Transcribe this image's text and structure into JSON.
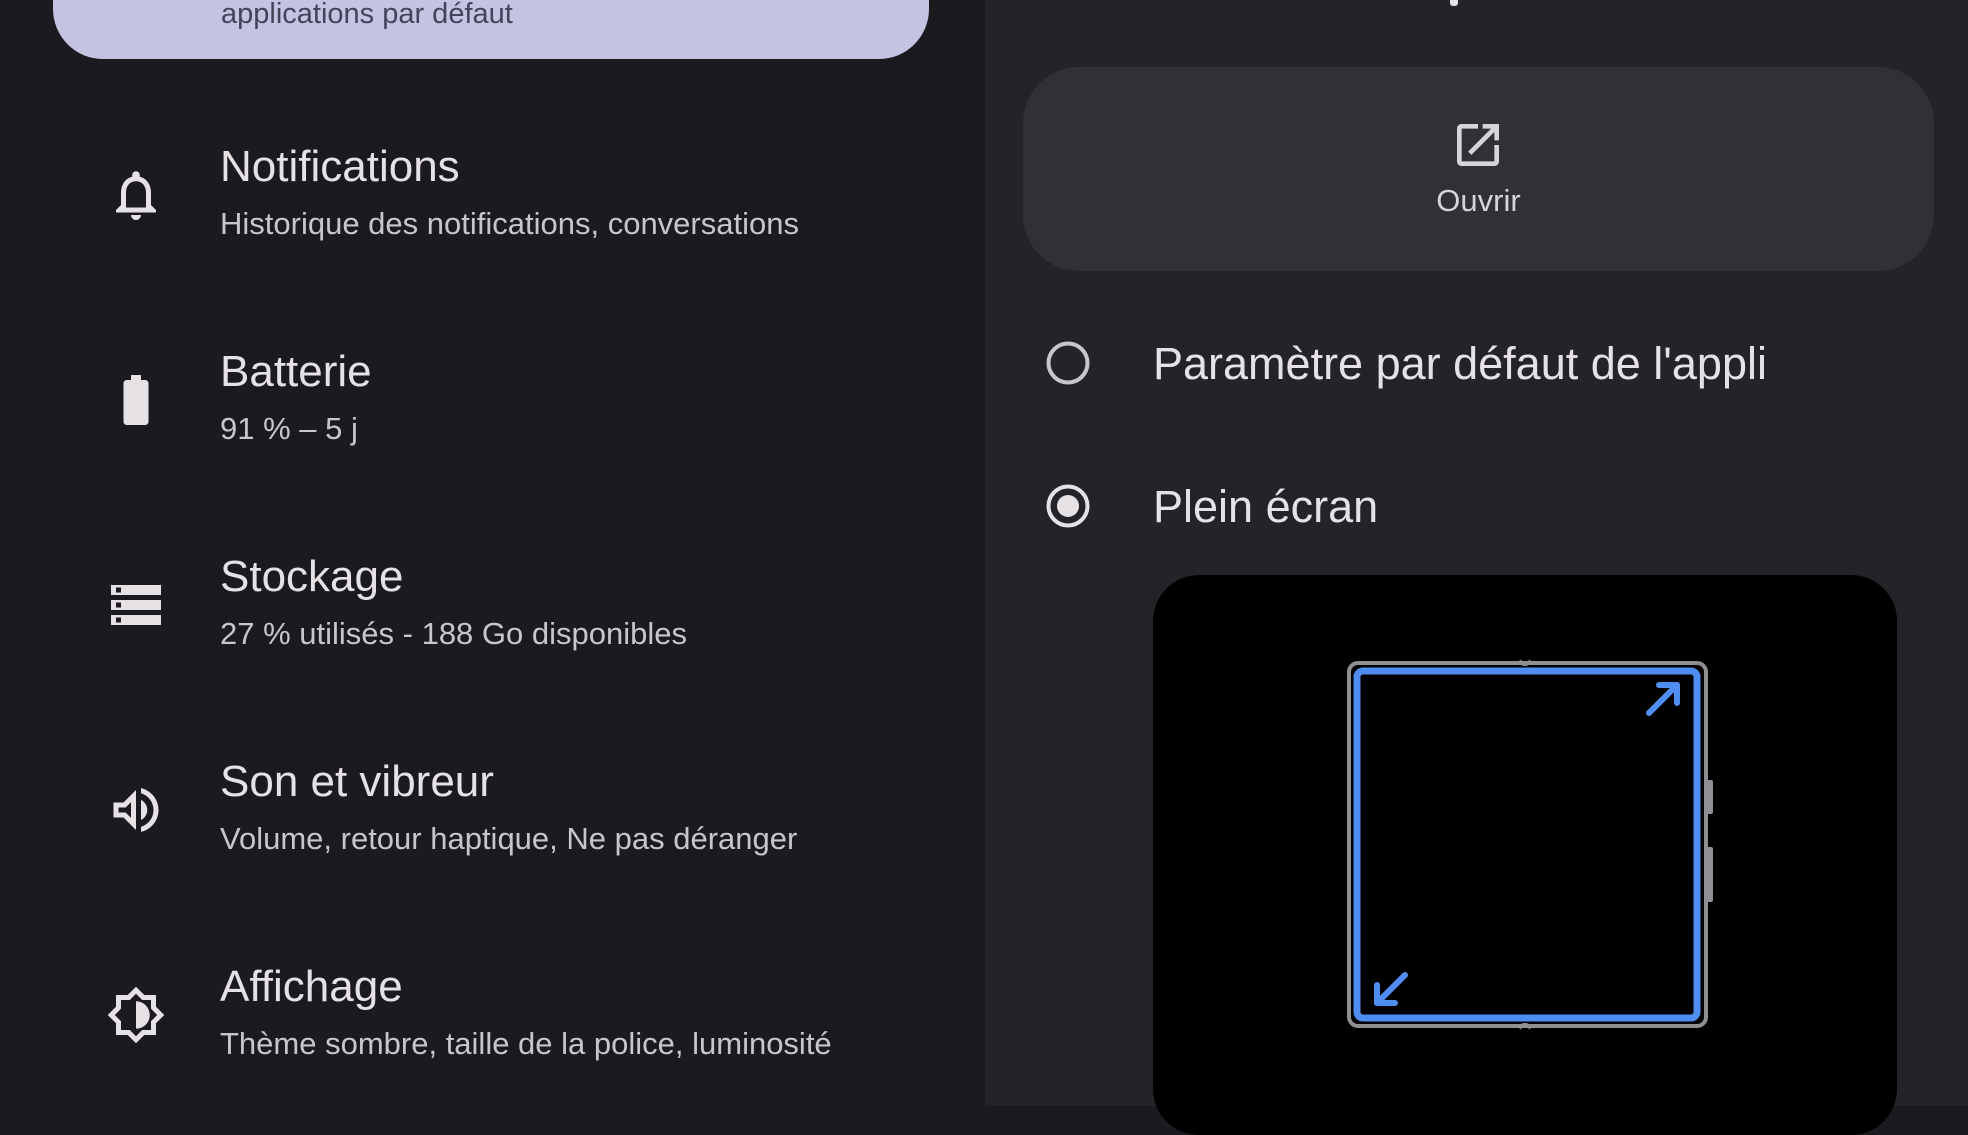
{
  "left_panel": {
    "selected_item_subtitle": "applications par défaut",
    "items": [
      {
        "title": "Notifications",
        "subtitle": "Historique des notifications, conversations",
        "icon": "bell-icon"
      },
      {
        "title": "Batterie",
        "subtitle": "91 % – 5 j",
        "icon": "battery-icon"
      },
      {
        "title": "Stockage",
        "subtitle": "27 % utilisés - 188 Go disponibles",
        "icon": "storage-icon"
      },
      {
        "title": "Son et vibreur",
        "subtitle": "Volume, retour haptique, Ne pas déranger",
        "icon": "volume-icon"
      },
      {
        "title": "Affichage",
        "subtitle": "Thème sombre, taille de la police, luminosité",
        "icon": "brightness-icon"
      }
    ]
  },
  "right_panel": {
    "open_button": {
      "label": "Ouvrir",
      "icon": "open-external-icon"
    },
    "options": [
      {
        "label": "Paramètre par défaut de l'appli",
        "selected": false
      },
      {
        "label": "Plein écran",
        "selected": true
      }
    ],
    "preview_icon": "fullscreen-foldable-preview"
  },
  "colors": {
    "background": "#1b1b1f",
    "right_panel": "#242428",
    "selected_item": "#c5c3e2",
    "button_surface": "#313036",
    "accent_blue": "#4f8df0",
    "radio_selected": "#e6e1e5"
  }
}
